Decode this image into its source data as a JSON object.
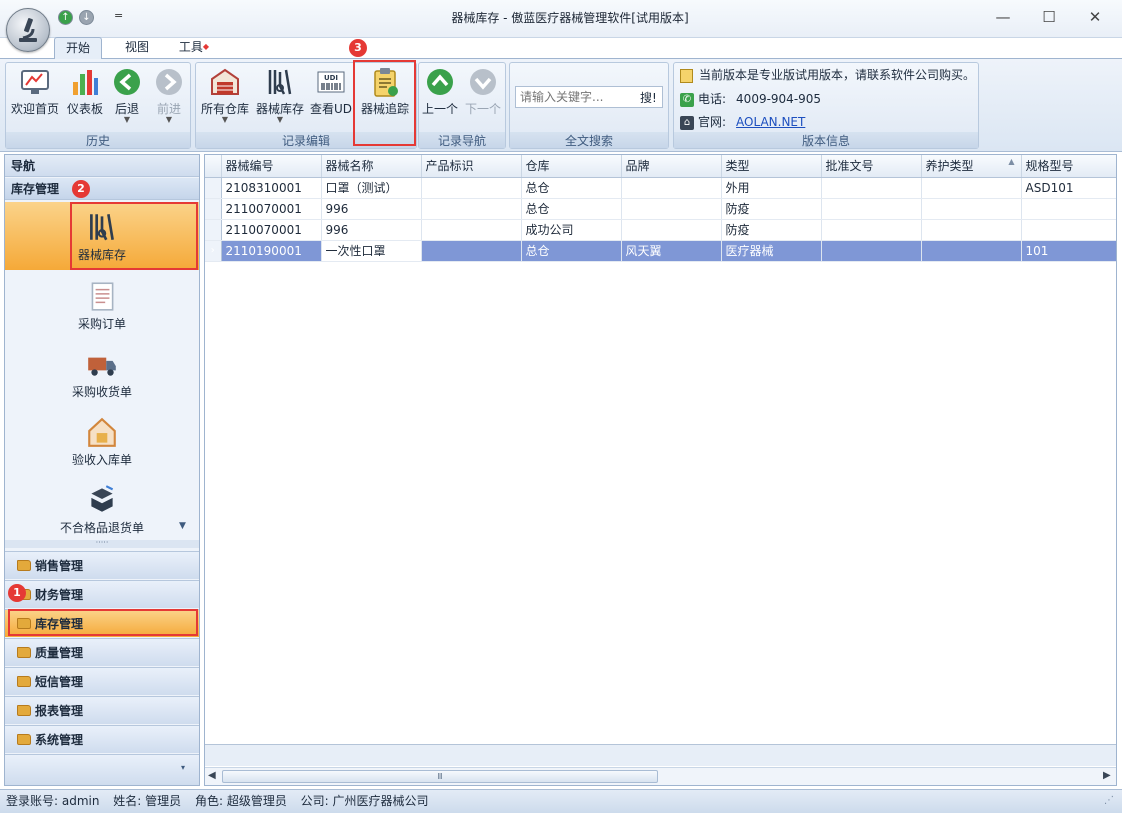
{
  "window": {
    "title": "器械库存 - 傲蓝医疗器械管理软件[试用版本]",
    "minimize": "—",
    "maximize": "☐",
    "close": "✕"
  },
  "quick_access": {
    "menu_glyph": "="
  },
  "tabs": [
    {
      "label": "开始"
    },
    {
      "label": "视图"
    },
    {
      "label": "工具"
    }
  ],
  "ribbon": {
    "groups": {
      "history": "历史",
      "record_edit": "记录编辑",
      "record_nav": "记录导航",
      "full_search": "全文搜索",
      "version_info": "版本信息"
    },
    "buttons": {
      "welcome": "欢迎首页",
      "dashboard": "仪表板",
      "back": "后退",
      "forward": "前进",
      "all_warehouses": "所有仓库",
      "device_stock": "器械库存",
      "view_udi": "查看UD",
      "device_trace": "器械追踪",
      "prev": "上一个",
      "next": "下一个"
    },
    "search": {
      "placeholder": "请输入关键字...",
      "button": "搜!"
    },
    "info": {
      "notice": "当前版本是专业版试用版本，请联系软件公司购买。",
      "phone_label": "电话:",
      "phone": "4009-904-905",
      "website_label": "官网:",
      "website": "AOLAN.NET"
    },
    "udi_label": "UDI"
  },
  "nav": {
    "title": "导航",
    "section": "库存管理",
    "items": [
      {
        "label": "器械库存"
      },
      {
        "label": "采购订单"
      },
      {
        "label": "采购收货单"
      },
      {
        "label": "验收入库单"
      },
      {
        "label": "不合格品退货单"
      }
    ],
    "splitter": "·····",
    "categories": [
      {
        "label": "销售管理"
      },
      {
        "label": "财务管理"
      },
      {
        "label": "库存管理"
      },
      {
        "label": "质量管理"
      },
      {
        "label": "短信管理"
      },
      {
        "label": "报表管理"
      },
      {
        "label": "系统管理"
      }
    ]
  },
  "grid": {
    "columns": [
      "器械编号",
      "器械名称",
      "产品标识",
      "仓库",
      "品牌",
      "类型",
      "批准文号",
      "养护类型",
      "规格型号"
    ],
    "rows": [
      [
        "2108310001",
        "口罩（测试）",
        "",
        "总仓",
        "",
        "外用",
        "",
        "",
        "ASD101"
      ],
      [
        "2110070001",
        "996",
        "",
        "总仓",
        "",
        "防疫",
        "",
        "",
        ""
      ],
      [
        "2110070001",
        "996",
        "",
        "成功公司",
        "",
        "防疫",
        "",
        "",
        ""
      ],
      [
        "2110190001",
        "一次性口罩",
        "",
        "总仓",
        "风天翼",
        "医疗器械",
        "",
        "",
        "101"
      ]
    ],
    "selected_row": 3,
    "sort_indicator": "▲",
    "row_marker": "›",
    "scroll_thumb_glyph": "Ⅲ",
    "scroll_left": "◀",
    "scroll_right": "▶"
  },
  "annotations": [
    "1",
    "2",
    "3"
  ],
  "status": {
    "account": "登录账号: admin",
    "name": "姓名: 管理员",
    "role": "角色: 超级管理员",
    "company": "公司: 广州医疗器械公司",
    "grip": "⋰"
  },
  "colors": {
    "accent": "#7f97d6",
    "highlight_orange": "#f7b955",
    "annotation_red": "#e53935"
  }
}
